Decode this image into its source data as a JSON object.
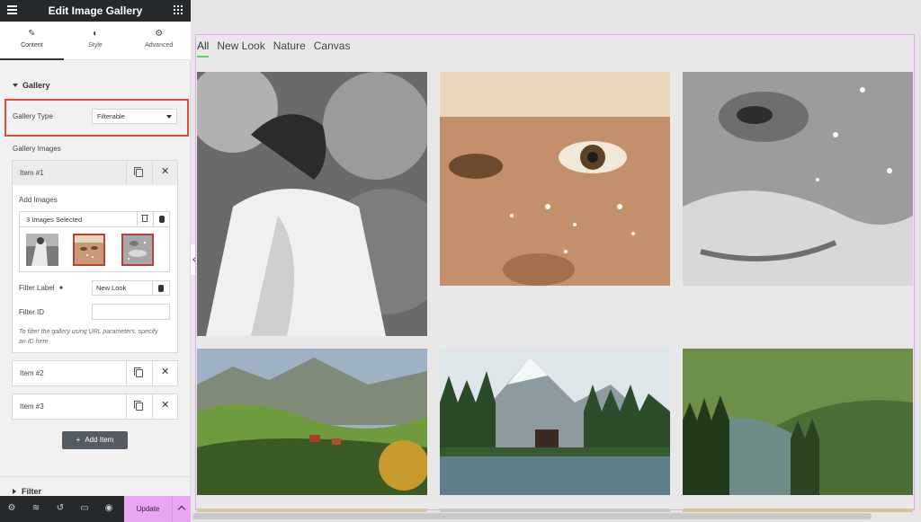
{
  "editor": {
    "title": "Edit Image Gallery",
    "tabs": [
      {
        "label": "Content",
        "icon": "pencil-icon"
      },
      {
        "label": "Style",
        "icon": "half-circle-icon"
      },
      {
        "label": "Advanced",
        "icon": "gear-icon"
      }
    ],
    "section_gallery": "Gallery",
    "gallery_type_label": "Gallery Type",
    "gallery_type_value": "Filterable",
    "gallery_images_label": "Gallery Images",
    "items": [
      {
        "name": "Item #1"
      },
      {
        "name": "Item #2"
      },
      {
        "name": "Item #3"
      }
    ],
    "item1": {
      "add_images_label": "Add Images",
      "images_selected": "3 Images Selected",
      "filter_label_label": "Filter Label",
      "filter_label_value": "New Look",
      "filter_id_label": "Filter ID",
      "filter_id_value": "",
      "hint": "To filter the gallery using URL parameters, specify an ID here"
    },
    "add_item_label": "Add Item",
    "section_filter": "Filter",
    "footer": {
      "update_label": "Update",
      "icons": [
        "gear-icon",
        "layers-icon",
        "history-icon",
        "responsive-icon",
        "eye-icon"
      ]
    }
  },
  "canvas": {
    "filters": [
      {
        "label": "All",
        "active": true
      },
      {
        "label": "New Look",
        "active": false
      },
      {
        "label": "Nature",
        "active": false
      },
      {
        "label": "Canvas",
        "active": false
      }
    ],
    "accent_color": "#61ce70",
    "frame_color": "#e2a6f0"
  }
}
